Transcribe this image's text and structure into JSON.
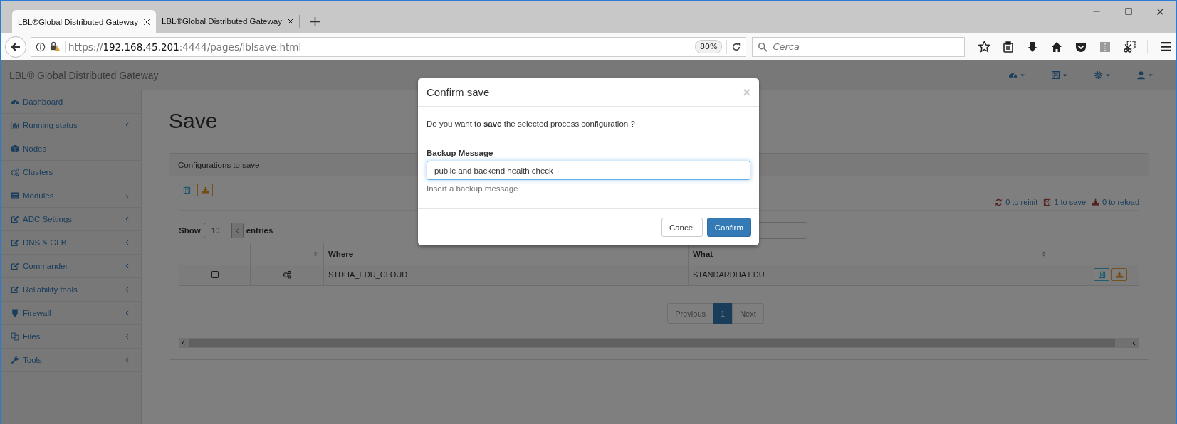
{
  "browser": {
    "tabs": [
      {
        "title": "LBL®Global Distributed Gateway",
        "selected": true
      },
      {
        "title": "LBL®Global Distributed Gateway",
        "selected": false
      }
    ],
    "url": {
      "scheme": "https://",
      "host": "192.168.45.201",
      "rest": ":4444/pages/lblsave.html"
    },
    "zoom": "80%",
    "search": {
      "placeholder": "Cerca"
    }
  },
  "app": {
    "title": "LBL® Global Distributed Gateway"
  },
  "sidebar": {
    "items": [
      {
        "label": "Dashboard",
        "expandable": false
      },
      {
        "label": "Running status",
        "expandable": true
      },
      {
        "label": "Nodes",
        "expandable": false
      },
      {
        "label": "Clusters",
        "expandable": false
      },
      {
        "label": "Modules",
        "expandable": true
      },
      {
        "label": "ADC Settings",
        "expandable": true
      },
      {
        "label": "DNS & GLB",
        "expandable": true
      },
      {
        "label": "Commander",
        "expandable": true
      },
      {
        "label": "Reliability tools",
        "expandable": true
      },
      {
        "label": "Firewall",
        "expandable": true
      },
      {
        "label": "Files",
        "expandable": true
      },
      {
        "label": "Tools",
        "expandable": true
      }
    ]
  },
  "page": {
    "heading": "Save"
  },
  "panel": {
    "title": "Configurations to save",
    "counters": [
      {
        "kind": "reinit",
        "text": "0 to reinit"
      },
      {
        "kind": "save",
        "text": "1 to save"
      },
      {
        "kind": "reload",
        "text": "0 to reload"
      }
    ],
    "length": {
      "before": "Show",
      "value": "10",
      "after": "entries"
    },
    "columns": [
      {
        "label": "Where"
      },
      {
        "label": "What"
      }
    ],
    "rows": [
      {
        "checked": false,
        "where": "STDHA_EDU_CLOUD",
        "what": "STANDARDHA EDU"
      }
    ],
    "pagination": [
      {
        "label": "Previous",
        "selected": false,
        "disabled": true
      },
      {
        "label": "1",
        "selected": true,
        "disabled": false
      },
      {
        "label": "Next",
        "selected": false,
        "disabled": true
      }
    ]
  },
  "modal": {
    "title": "Confirm save",
    "close": "×",
    "message": "Do you want to **save** the selected process configuration ?",
    "field_label": "Backup Message",
    "value": "public and backend health check",
    "help": "Insert a backup message",
    "buttons": [
      {
        "label": "Cancel",
        "kind": "default"
      },
      {
        "label": "Confirm",
        "kind": "primary"
      }
    ]
  }
}
